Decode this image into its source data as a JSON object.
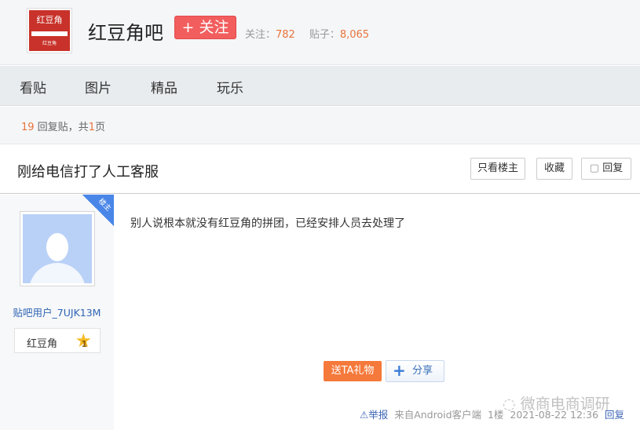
{
  "header": {
    "logo_text": "红豆角",
    "forum_name": "红豆角吧",
    "follow_label": "+ 关注",
    "followers_label": "关注：",
    "followers": "782",
    "posts_label": "贴子：",
    "posts": "8,065"
  },
  "nav": [
    "看贴",
    "图片",
    "精品",
    "玩乐"
  ],
  "page_info": {
    "replies": "19",
    "replies_label": " 回复贴，共",
    "pages": "1",
    "pages_label": "页"
  },
  "thread": {
    "title": "刚给电信打了人工客服",
    "buttons": {
      "only_op": "只看楼主",
      "favorite": "收藏",
      "reply": "回复"
    }
  },
  "post": {
    "op_tag": "楼主",
    "username": "贴吧用户_7UJK13M",
    "badge_name": "红豆角",
    "badge_level": "1",
    "content": "别人说根本就没有红豆角的拼团，已经安排人员去处理了",
    "gift_label": "送TA礼物",
    "share_label": "分享",
    "report_label": "举报",
    "source": "来自Android客户端",
    "floor": "1楼",
    "time": "2021-08-22 12:36",
    "reply_label": "回复"
  },
  "watermark": "微商电商调研"
}
